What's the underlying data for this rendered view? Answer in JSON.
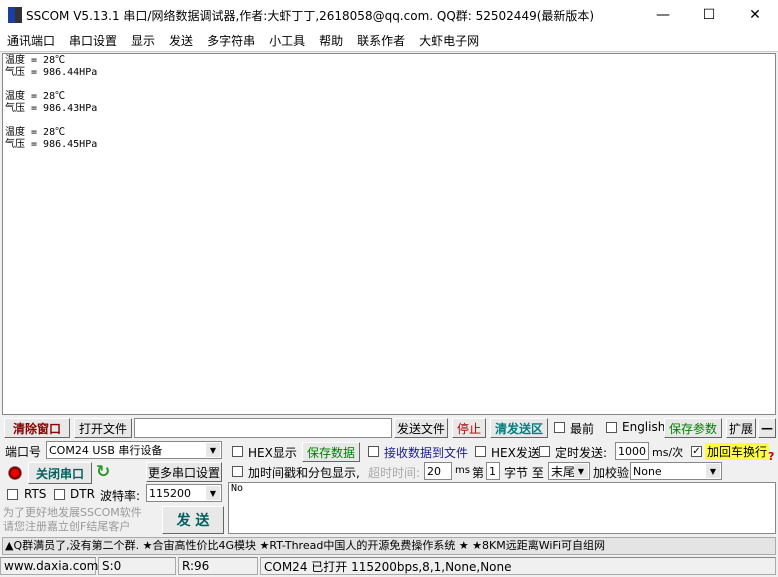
{
  "title": "SSCOM V5.13.1 串口/网络数据调试器,作者:大虾丁丁,2618058@qq.com. QQ群: 52502449(最新版本)",
  "menu": [
    "通讯端口",
    "串口设置",
    "显示",
    "发送",
    "多字符串",
    "小工具",
    "帮助",
    "联系作者",
    "大虾电子网"
  ],
  "receive_text": "温度 = 28℃\n气压 = 986.44HPa\n\n温度 = 28℃\n气压 = 986.43HPa\n\n温度 = 28℃\n气压 = 986.45HPa\n\n",
  "toolbar": {
    "clear": "清除窗口",
    "open_file": "打开文件",
    "file_path": "",
    "send_file": "发送文件",
    "stop": "停止",
    "clear_send": "清发送区",
    "topmost": "最前",
    "english": "English",
    "save_params": "保存参数",
    "expand": "扩展",
    "collapse": "—"
  },
  "port": {
    "label": "端口号",
    "value": "COM24 USB 串行设备",
    "hex_display": "HEX显示",
    "save_data": "保存数据",
    "recv_to_file": "接收数据到文件",
    "hex_send": "HEX发送",
    "timed_send": "定时发送:",
    "interval": "1000",
    "interval_unit": "ms/次",
    "add_crlf": "加回车换行",
    "crlf_checked": true,
    "close_port": "关闭串口",
    "more_settings": "更多串口设置",
    "timestamp": "加时间戳和分包显示,",
    "timeout_label": "超时时间:",
    "timeout": "20",
    "timeout_unit": "ms",
    "byte_prefix": "第",
    "byte_from": "1",
    "byte_label": "字节 至",
    "byte_to": "末尾",
    "checksum_label": "加校验",
    "checksum": "None",
    "rts": "RTS",
    "dtr": "DTR",
    "baud_label": "波特率:",
    "baud": "115200",
    "promo": "为了更好地发展SSCOM软件\n请您注册嘉立创F结尾客户",
    "send": "发 送",
    "send_text": "No",
    "help": "?"
  },
  "ad": "▲Q群满员了,没有第二个群. ★合宙高性价比4G模块 ★RT-Thread中国人的开源免费操作系统 ★ ★8KM远距离WiFi可自组网",
  "status": {
    "site": "www.daxia.com",
    "sent": "S:0",
    "recv": "R:96",
    "port_status": "COM24 已打开  115200bps,8,1,None,None"
  }
}
